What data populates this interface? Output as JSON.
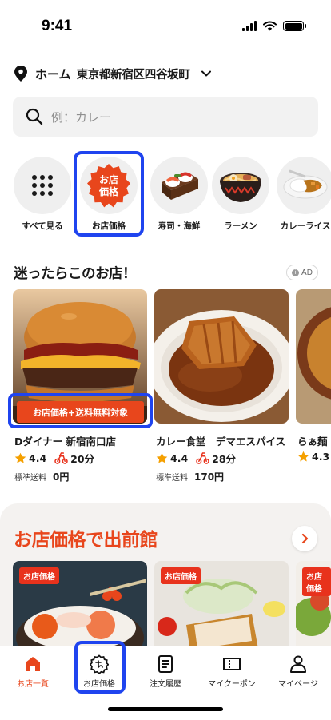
{
  "status_bar": {
    "time": "9:41"
  },
  "location": {
    "home_label": "ホーム",
    "address": "東京都新宿区四谷坂町"
  },
  "search": {
    "placeholder": "例：カレー"
  },
  "categories": [
    {
      "label": "すべて見る",
      "icon": "grid-icon"
    },
    {
      "label": "お店価格",
      "icon": "store-price-icon",
      "badge_text": "お店価格"
    },
    {
      "label": "寿司・海鮮",
      "icon": "sushi-icon"
    },
    {
      "label": "ラーメン",
      "icon": "ramen-icon"
    },
    {
      "label": "カレーライス",
      "icon": "curry-icon"
    }
  ],
  "section1": {
    "title": "迷ったらこのお店！",
    "ad_label": "AD",
    "promo_ribbon": "お店価格+送料無料対象",
    "stores": [
      {
        "name": "Dダイナー 新宿南口店",
        "rating": "4.4",
        "time": "20分",
        "fee_label": "標準送料",
        "fee": "0円"
      },
      {
        "name": "カレー食堂　デマエスパイス",
        "rating": "4.4",
        "time": "28分",
        "fee_label": "標準送料",
        "fee": "170円"
      },
      {
        "name": "らぁ麺 じ",
        "rating": "4.3"
      }
    ]
  },
  "section2": {
    "title": "お店価格で出前館",
    "tag": "お店価格"
  },
  "bottom_nav": [
    {
      "label": "お店一覧",
      "icon": "home-icon",
      "active": true
    },
    {
      "label": "お店価格",
      "icon": "store-price-icon",
      "active": false
    },
    {
      "label": "注文履歴",
      "icon": "receipt-icon",
      "active": false
    },
    {
      "label": "マイクーポン",
      "icon": "coupon-icon",
      "active": false
    },
    {
      "label": "マイページ",
      "icon": "person-icon",
      "active": false
    }
  ],
  "colors": {
    "accent": "#e8461c",
    "highlight": "#1f44ef",
    "star": "#f5a000"
  }
}
